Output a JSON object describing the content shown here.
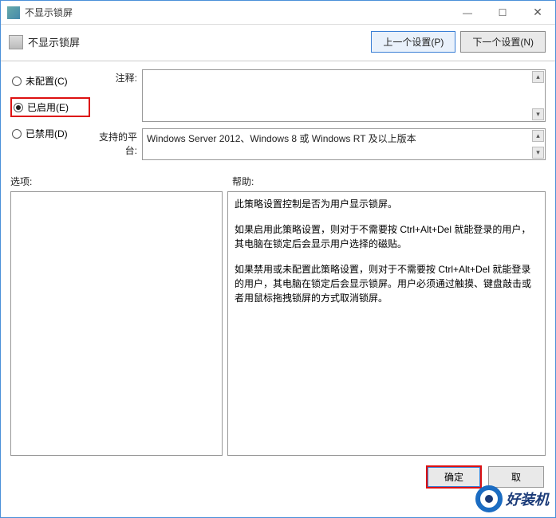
{
  "window": {
    "title": "不显示锁屏",
    "min": "—",
    "max": "☐",
    "close": "✕"
  },
  "header": {
    "title": "不显示锁屏",
    "prev_setting": "上一个设置(P)",
    "next_setting": "下一个设置(N)"
  },
  "radio": {
    "not_configured": "未配置(C)",
    "enabled": "已启用(E)",
    "disabled": "已禁用(D)",
    "selected": "enabled"
  },
  "labels": {
    "comment": "注释:",
    "platforms": "支持的平台:",
    "options": "选项:",
    "help": "帮助:"
  },
  "platforms_text": "Windows Server 2012、Windows 8 或 Windows RT 及以上版本",
  "help_paragraphs": [
    "此策略设置控制是否为用户显示锁屏。",
    "如果启用此策略设置，则对于不需要按 Ctrl+Alt+Del 就能登录的用户，其电脑在锁定后会显示用户选择的磁贴。",
    "如果禁用或未配置此策略设置，则对于不需要按 Ctrl+Alt+Del 就能登录的用户，其电脑在锁定后会显示锁屏。用户必须通过触摸、键盘敲击或者用鼠标拖拽锁屏的方式取消锁屏。"
  ],
  "footer": {
    "ok": "确定",
    "cancel": "取"
  },
  "watermark": "好装机"
}
